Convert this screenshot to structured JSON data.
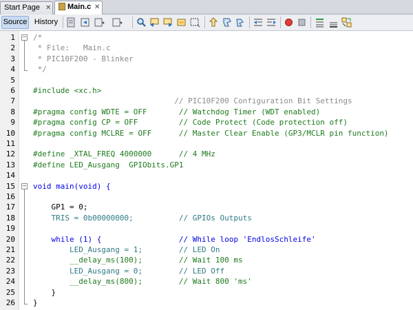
{
  "tabs": [
    {
      "label": "Start Page",
      "close": "✕",
      "active": false
    },
    {
      "label": "Main.c",
      "close": "✕",
      "active": true
    }
  ],
  "views": {
    "source": "Source",
    "history": "History"
  },
  "toolbar_icons": [
    "last-edit-icon",
    "back-icon",
    "forward-icon",
    "find-icon",
    "find-previous-icon",
    "find-next-icon",
    "find-selection-icon",
    "toggle-highlight-icon",
    "prev-bookmark-icon",
    "next-bookmark-icon",
    "toggle-bookmark-icon",
    "shift-left-icon",
    "shift-right-icon",
    "record-macro-icon",
    "stop-macro-icon",
    "comment-icon",
    "uncomment-icon",
    "diff-icon"
  ],
  "lines": [
    {
      "n": "1",
      "text": "/*"
    },
    {
      "n": "2",
      "text": " * File:   Main.c"
    },
    {
      "n": "3",
      "text": " * PIC10F200 - Blinker"
    },
    {
      "n": "4",
      "text": " */"
    },
    {
      "n": "5",
      "text": ""
    },
    {
      "n": "6",
      "text": "#include <xc.h>"
    },
    {
      "n": "7",
      "text": "                               // PIC10F200 Configuration Bit Settings"
    },
    {
      "n": "8",
      "text": "#pragma config WDTE = OFF       // Watchdog Timer (WDT enabled)"
    },
    {
      "n": "9",
      "text": "#pragma config CP = OFF         // Code Protect (Code protection off)"
    },
    {
      "n": "10",
      "text": "#pragma config MCLRE = OFF      // Master Clear Enable (GP3/MCLR pin function)"
    },
    {
      "n": "11",
      "text": ""
    },
    {
      "n": "12",
      "text": "#define _XTAL_FREQ 4000000      // 4 MHz"
    },
    {
      "n": "13",
      "text": "#define LED_Ausgang  GPIObits.GP1"
    },
    {
      "n": "14",
      "text": ""
    },
    {
      "n": "15",
      "text": "void main(void) {"
    },
    {
      "n": "16",
      "text": ""
    },
    {
      "n": "17",
      "text": "    GP1 = 0;"
    },
    {
      "n": "18",
      "text": "    TRIS = 0b00000000;          // GPIOs Outputs"
    },
    {
      "n": "19",
      "text": ""
    },
    {
      "n": "20",
      "text": "    while (1) {                 // While loop 'EndlosSchleife'"
    },
    {
      "n": "21",
      "text": "        LED_Ausgang = 1;        // LED On"
    },
    {
      "n": "22",
      "text": "        __delay_ms(100);        // Wait 100 ms"
    },
    {
      "n": "23",
      "text": "        LED_Ausgang = 0;        // LED Off"
    },
    {
      "n": "24",
      "text": "        __delay_ms(800);        // Wait 800 'ms'"
    },
    {
      "n": "25",
      "text": "    }"
    },
    {
      "n": "26",
      "text": "}"
    }
  ],
  "colors": {
    "comment": "#8a8a8a",
    "preprocessor": "#1d7a1d",
    "include": "#d2691e",
    "keyword": "#0000e6",
    "highlight": "#e4f4b0"
  }
}
